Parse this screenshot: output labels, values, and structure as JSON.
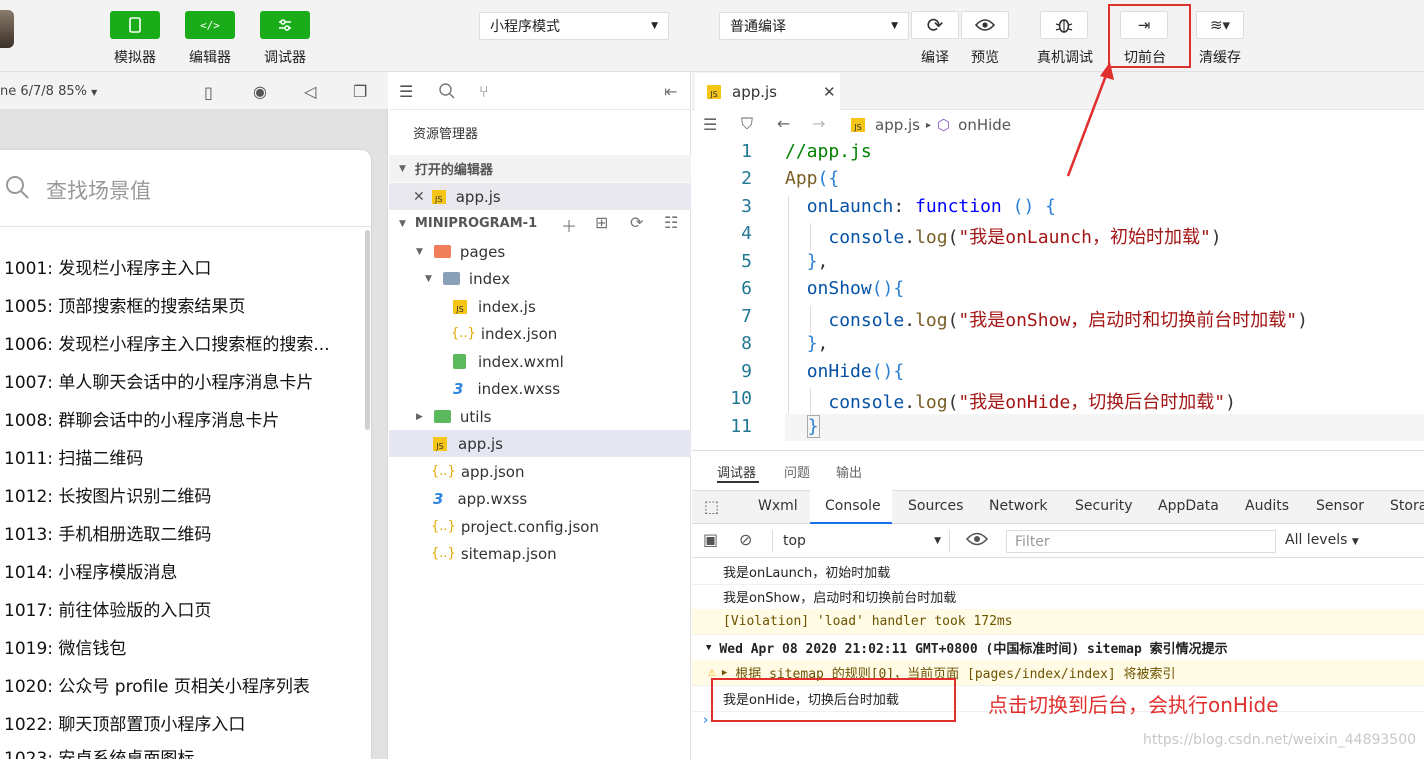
{
  "toolbar": {
    "simulator_label": "模拟器",
    "editor_label": "编辑器",
    "debugger_label": "调试器",
    "mode_select": "小程序模式",
    "compile_select": "普通编译",
    "compile_label": "编译",
    "preview_label": "预览",
    "remote_debug_label": "真机调试",
    "background_label": "切前台",
    "clear_cache_label": "清缓存"
  },
  "simulator": {
    "device": "ne 6/7/8 85%",
    "search_placeholder": "查找场景值",
    "scenes": [
      "1001: 发现栏小程序主入口",
      "1005: 顶部搜索框的搜索结果页",
      "1006: 发现栏小程序主入口搜索框的搜索...",
      "1007: 单人聊天会话中的小程序消息卡片",
      "1008: 群聊会话中的小程序消息卡片",
      "1011: 扫描二维码",
      "1012: 长按图片识别二维码",
      "1013: 手机相册选取二维码",
      "1014: 小程序模版消息",
      "1017: 前往体验版的入口页",
      "1019: 微信钱包",
      "1020: 公众号 profile 页相关小程序列表",
      "1022: 聊天顶部置顶小程序入口",
      "1023: 安卓系统桌面图标"
    ]
  },
  "explorer": {
    "title": "资源管理器",
    "open_editors": "打开的编辑器",
    "open_file": "app.js",
    "project": "MINIPROGRAM-1",
    "tree": {
      "pages": "pages",
      "index": "index",
      "index_js": "index.js",
      "index_json": "index.json",
      "index_wxml": "index.wxml",
      "index_wxss": "index.wxss",
      "utils": "utils",
      "app_js": "app.js",
      "app_json": "app.json",
      "app_wxss": "app.wxss",
      "project_config": "project.config.json",
      "sitemap": "sitemap.json"
    }
  },
  "editor": {
    "tab": "app.js",
    "breadcrumb_file": "app.js",
    "breadcrumb_symbol": "onHide",
    "line_numbers": [
      "1",
      "2",
      "3",
      "4",
      "5",
      "6",
      "7",
      "8",
      "9",
      "10",
      "11"
    ],
    "code": {
      "l1": "//app.js",
      "l2_fn": "App",
      "l3_key": "onLaunch",
      "l3_kw": "function",
      "l4_obj": "console",
      "l4_fn": "log",
      "l4_str": "\"我是onLaunch，初始时加载\"",
      "l6_key": "onShow",
      "l7_obj": "console",
      "l7_fn": "log",
      "l7_str": "\"我是onShow，启动时和切换前台时加载\"",
      "l9_key": "onHide",
      "l10_obj": "console",
      "l10_fn": "log",
      "l10_str": "\"我是onHide，切换后台时加载\""
    }
  },
  "devtools": {
    "panel_tabs": [
      "调试器",
      "问题",
      "输出"
    ],
    "tabs": [
      "Wxml",
      "Console",
      "Sources",
      "Network",
      "Security",
      "AppData",
      "Audits",
      "Sensor",
      "Stora"
    ],
    "context": "top",
    "filter_placeholder": "Filter",
    "levels": "All levels",
    "logs": {
      "l1": "我是onLaunch，初始时加载",
      "l2": "我是onShow，启动时和切换前台时加载",
      "l3": "[Violation] 'load' handler took 172ms",
      "l4": "Wed Apr 08 2020 21:02:11 GMT+0800 (中国标准时间) sitemap 索引情况提示",
      "l5": "根据 sitemap 的规则[0]，当前页面 [pages/index/index] 将被索引",
      "l6": "我是onHide，切换后台时加载"
    }
  },
  "annotation": "点击切换到后台，会执行onHide",
  "watermark": "https://blog.csdn.net/weixin_44893500",
  "colors": {
    "accent_green": "#1aad19",
    "annotation_red": "#e0302e"
  }
}
